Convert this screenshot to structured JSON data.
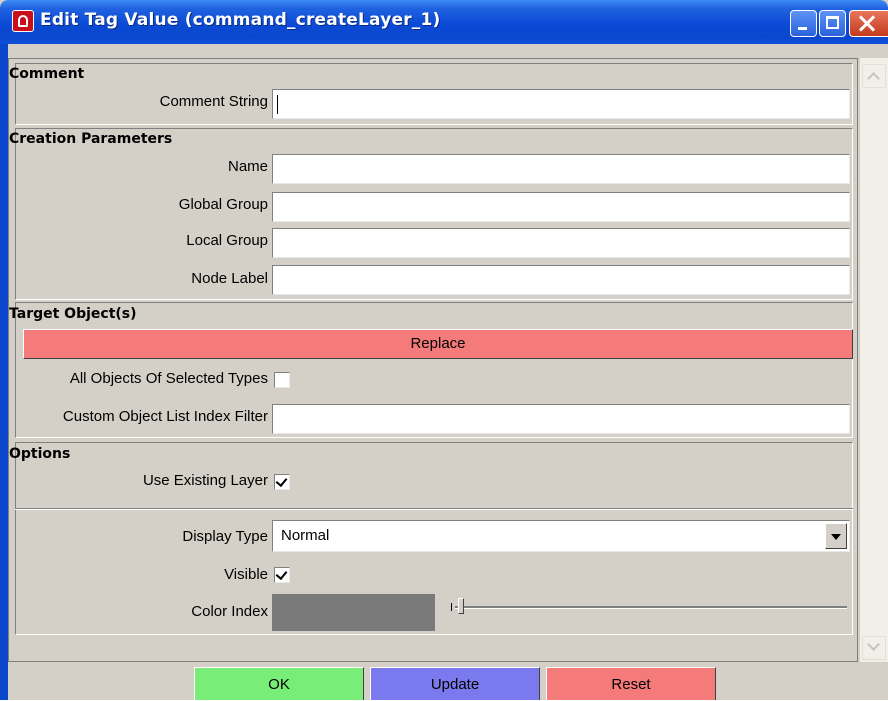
{
  "window": {
    "title": "Edit Tag Value (command_createLayer_1)",
    "icons": {
      "app": "app-logo-icon",
      "minimize": "minimize-icon",
      "maximize": "maximize-icon",
      "close": "close-icon"
    }
  },
  "sections": {
    "comment": {
      "title": "Comment",
      "comment_string_label": "Comment String",
      "comment_string_value": ""
    },
    "creation": {
      "title": "Creation Parameters",
      "name_label": "Name",
      "name_value": "",
      "global_group_label": "Global Group",
      "global_group_value": "",
      "local_group_label": "Local Group",
      "local_group_value": "",
      "node_label_label": "Node Label",
      "node_label_value": ""
    },
    "target": {
      "title": "Target Object(s)",
      "replace_label": "Replace",
      "all_objects_label": "All Objects Of Selected Types",
      "all_objects_checked": false,
      "custom_filter_label": "Custom Object List Index Filter",
      "custom_filter_value": ""
    },
    "options": {
      "title": "Options",
      "use_existing_label": "Use Existing Layer",
      "use_existing_checked": true,
      "display_type_label": "Display Type",
      "display_type_value": "Normal",
      "visible_label": "Visible",
      "visible_checked": true,
      "color_index_label": "Color Index",
      "color_index_swatch": "#7a7a7a",
      "color_index_slider": 0
    }
  },
  "buttons": {
    "ok": "OK",
    "update": "Update",
    "reset": "Reset"
  },
  "colors": {
    "ok": "#78ee78",
    "update": "#7a7aee",
    "reset": "#f57a7a",
    "replace": "#f57a7a",
    "titlebar": "#0a47cc"
  }
}
